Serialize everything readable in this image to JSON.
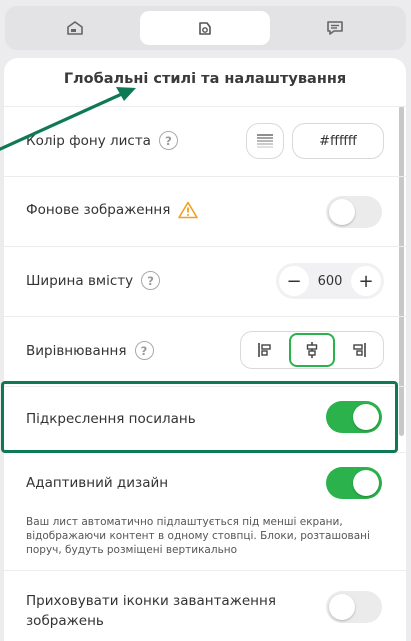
{
  "tabs": [
    {
      "name": "tab-content",
      "icon": "envelope-icon"
    },
    {
      "name": "tab-styles",
      "icon": "paint-bucket-icon"
    },
    {
      "name": "tab-comments",
      "icon": "message-icon"
    }
  ],
  "panel": {
    "title": "Глобальні стилі та налаштування"
  },
  "settings": {
    "bg_color": {
      "label": "Колір фону листа",
      "help": "?",
      "value": "#ffffff"
    },
    "bg_image": {
      "label": "Фонове зображення",
      "enabled": false
    },
    "content_width": {
      "label": "Ширина вмісту",
      "help": "?",
      "value": "600",
      "minus": "−",
      "plus": "+"
    },
    "alignment": {
      "label": "Вирівнювання",
      "help": "?",
      "selected": "center",
      "options": [
        "left",
        "center",
        "right"
      ]
    },
    "underline_links": {
      "label": "Підкреслення посилань",
      "enabled": true
    },
    "responsive": {
      "label": "Адаптивний дизайн",
      "enabled": true,
      "description": "Ваш лист автоматично підлаштується під менші екрани, відображаючи контент в одному стовпці. Блоки, розташовані поруч, будуть розміщені вертикально"
    },
    "hide_download_icons": {
      "label": "Приховувати іконки завантаження зображень",
      "enabled": false
    }
  },
  "colors": {
    "accent": "#2bb24c",
    "highlight": "#0e7a54",
    "warning": "#f0a020"
  }
}
